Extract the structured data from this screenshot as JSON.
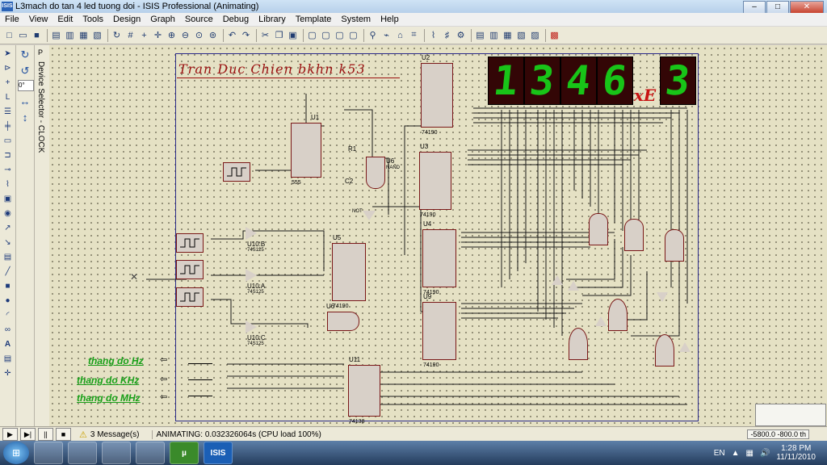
{
  "window": {
    "app_icon": "ISIS",
    "title": "L3mach do tan 4 led tuong doi - ISIS Professional (Animating)",
    "buttons": {
      "minimize": "–",
      "maximize": "□",
      "close": "✕"
    }
  },
  "menu": [
    "File",
    "View",
    "Edit",
    "Tools",
    "Design",
    "Graph",
    "Source",
    "Debug",
    "Library",
    "Template",
    "System",
    "Help"
  ],
  "toolbar_icons": [
    "new-icon",
    "open-icon",
    "save-icon",
    "import-icon",
    "export-icon",
    "print-icon",
    "area-icon",
    "refresh-icon",
    "grid-icon",
    "origin-icon",
    "pan-icon",
    "zoom-in-icon",
    "zoom-out-icon",
    "zoom-all-icon",
    "zoom-area-icon",
    "undo-icon",
    "redo-icon",
    "cut-icon",
    "copy-icon",
    "paste-icon",
    "block-copy-icon",
    "block-move-icon",
    "block-rotate-icon",
    "block-delete-icon",
    "pick-icon",
    "make-device-icon",
    "packaging-icon",
    "decompose-icon",
    "wire-autorouter-icon",
    "search-tag-icon",
    "property-icon",
    "design-explorer-icon",
    "new-sheet-icon",
    "remove-sheet-icon",
    "exit-parent-icon",
    "bom-icon",
    "netlist-icon"
  ],
  "left_tools": [
    "select-icon",
    "component-icon",
    "junction-icon",
    "label-icon",
    "text-script-icon",
    "bus-icon",
    "subcircuit-icon",
    "terminal-icon",
    "pin-icon",
    "graph-icon",
    "tape-icon",
    "generator-icon",
    "probe-v-icon",
    "probe-i-icon",
    "instrument-icon",
    "line-icon",
    "box-icon",
    "circle-icon",
    "arc-icon",
    "path-icon",
    "text-icon",
    "symbol-icon",
    "marker-icon"
  ],
  "rotation": {
    "angle": "0°"
  },
  "device_selector": {
    "label": "Device Selector - CLOCK",
    "pin_icon": "P"
  },
  "schematic": {
    "credit_text": "Tran Duc Chien   bkhn  k53",
    "display_digits": [
      "1",
      "3",
      "4",
      "6"
    ],
    "exponent_label": "xE",
    "exponent_digit": "3",
    "range_labels": [
      "thang do Hz",
      "thang do KHz",
      "thang do MHz"
    ],
    "components": {
      "U1": "U1",
      "U2": "U2",
      "U3": "U3",
      "U4": "U4",
      "U5": "U5",
      "U6": "U6",
      "U6B": "U6",
      "U9": "U9",
      "U10B": "U10:B",
      "U10A": "U10:A",
      "U10C": "U10:C",
      "U11": "U11",
      "R1": "R1",
      "C2": "C2",
      "part_74190": "74190",
      "part_74125": "74S125",
      "part_555": "555",
      "part_74138": "74138",
      "part_nand": "NAND",
      "part_not": "NOT"
    }
  },
  "status": {
    "messages": "3 Message(s)",
    "animating": "ANIMATING: 0.032326064s (CPU load 100%)",
    "coords": "-5800.0    -800.0    th"
  },
  "taskbar": {
    "apps": [
      "",
      "",
      "",
      "",
      "µ",
      "ISIS"
    ],
    "lang": "EN",
    "time": "1:28 PM",
    "date": "11/11/2010"
  },
  "colors": {
    "led_on": "#18c418",
    "led_bg": "#330606",
    "wire": "#1a1a1a",
    "component_fill": "#d8d0c8",
    "component_stroke": "#7a1818",
    "pin_red": "#d41a1a",
    "pin_blue": "#1a3ad4",
    "credit": "#9a1010",
    "label_green": "#18a018"
  }
}
